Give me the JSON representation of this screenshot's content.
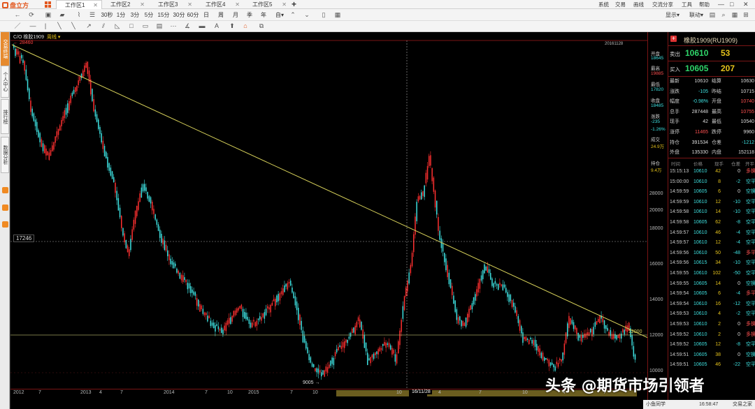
{
  "app": {
    "logo_text": "盘立方",
    "workspace_tabs": [
      "工作区1",
      "工作区2",
      "工作区3",
      "工作区4",
      "工作区5"
    ],
    "menu": [
      "系统",
      "交易",
      "画线",
      "交流分享",
      "工具",
      "帮助"
    ],
    "window_buttons": [
      "—",
      "□",
      "✕"
    ]
  },
  "toolbar": {
    "periods": [
      "30秒",
      "1分",
      "3分",
      "5分",
      "15分",
      "30分",
      "60分",
      "日",
      "周",
      "月",
      "季",
      "年",
      "自▾"
    ],
    "display_label": "显示▾",
    "link_label": "联动▾"
  },
  "sidebar": {
    "tabs": [
      "交易终端",
      "个人中心",
      "排行榜",
      "数据分析"
    ]
  },
  "chart": {
    "title": "C/O 橡胶1909",
    "ma_label": "周线 ▾",
    "high_label": "← 28460",
    "low_label": "9005 →",
    "ref_line_label": "17246",
    "level_label": "12000",
    "date_label": "16/11/28",
    "x_labels": [
      "2012",
      "7",
      "2013",
      "4",
      "7",
      "2014",
      "7",
      "10",
      "2015",
      "7",
      "10",
      "10",
      "16/11/28",
      "4",
      "7",
      "10",
      "4",
      "7"
    ],
    "y_labels": [
      "28000",
      "20000",
      "18000",
      "16000",
      "14000",
      "12000",
      "10000"
    ],
    "corner_date": "20161128",
    "colors": {
      "up": "#ff3030",
      "down": "#3ee0e0",
      "trend": "#d8d25a",
      "level": "#c8c878"
    }
  },
  "chart_data": {
    "type": "candlestick",
    "series": [
      {
        "name": "",
        "x_start": "2012",
        "x_end": "2019",
        "high": 28460,
        "low": 9005
      }
    ],
    "annotations": [
      "17246",
      "12000",
      "16/11/28"
    ]
  },
  "yaxis_stats": [
    {
      "label": "开盘",
      "value": "18645"
    },
    {
      "label": "最高",
      "value": "19885"
    },
    {
      "label": "最低",
      "value": "17820"
    },
    {
      "label": "收盘",
      "value": "18485"
    },
    {
      "label": "涨跌",
      "value": "-235"
    },
    {
      "label": "",
      "value": "-1.26%"
    },
    {
      "label": "成交",
      "value": "24.9万"
    },
    {
      "label": "持仓",
      "value": "9.4万"
    }
  ],
  "quote": {
    "title": "橡胶1909(RU1909)",
    "ask": {
      "label": "卖出",
      "price": "10610",
      "volume": "53"
    },
    "bid": {
      "label": "买入",
      "price": "10605",
      "volume": "207"
    },
    "stats": [
      [
        "最新",
        "10610",
        "结算",
        "10630"
      ],
      [
        "涨跌",
        "-105",
        "昨结",
        "10715"
      ],
      [
        "幅度",
        "-0.98%",
        "开盘",
        "10740"
      ],
      [
        "总手",
        "287448",
        "最高",
        "10755"
      ],
      [
        "现手",
        "42",
        "最低",
        "10540"
      ],
      [
        "涨停",
        "11465",
        "跌停",
        "9960"
      ],
      [
        "持仓",
        "391534",
        "仓差",
        "-1212"
      ],
      [
        "外盘",
        "135330",
        "内盘",
        "152118"
      ]
    ],
    "tick_headers": [
      "时间",
      "价格",
      "现手",
      "仓差",
      "开平"
    ],
    "ticks": [
      [
        "15:15:13",
        "10610",
        "42",
        "0",
        "多换"
      ],
      [
        "15:00:00",
        "10610",
        "8",
        "-2",
        "空平"
      ],
      [
        "14:59:59",
        "10605",
        "6",
        "0",
        "空换"
      ],
      [
        "14:59:59",
        "10610",
        "12",
        "-10",
        "空平"
      ],
      [
        "14:59:58",
        "10610",
        "14",
        "-10",
        "空平"
      ],
      [
        "14:59:58",
        "10605",
        "62",
        "-8",
        "空平"
      ],
      [
        "14:59:57",
        "10610",
        "46",
        "-4",
        "空平"
      ],
      [
        "14:59:57",
        "10610",
        "12",
        "-4",
        "空平"
      ],
      [
        "14:59:56",
        "10610",
        "50",
        "-48",
        "多平"
      ],
      [
        "14:59:56",
        "10615",
        "34",
        "-10",
        "空平"
      ],
      [
        "14:59:55",
        "10610",
        "102",
        "-50",
        "空平"
      ],
      [
        "14:59:55",
        "10605",
        "14",
        "0",
        "空换"
      ],
      [
        "14:59:54",
        "10605",
        "6",
        "-4",
        "多平"
      ],
      [
        "14:59:54",
        "10610",
        "16",
        "-12",
        "空平"
      ],
      [
        "14:59:53",
        "10610",
        "4",
        "-2",
        "空平"
      ],
      [
        "14:59:53",
        "10610",
        "2",
        "0",
        "多换"
      ],
      [
        "14:59:52",
        "10610",
        "2",
        "0",
        "多换"
      ],
      [
        "14:59:52",
        "10605",
        "12",
        "-8",
        "空平"
      ],
      [
        "14:59:51",
        "10605",
        "38",
        "0",
        "空换"
      ],
      [
        "14:59:51",
        "10605",
        "46",
        "-22",
        "空平"
      ]
    ]
  },
  "status": {
    "user": "小鱼同学",
    "time": "16:58:47",
    "label": "交易之家"
  },
  "watermark": "头条 @期货市场引领者"
}
